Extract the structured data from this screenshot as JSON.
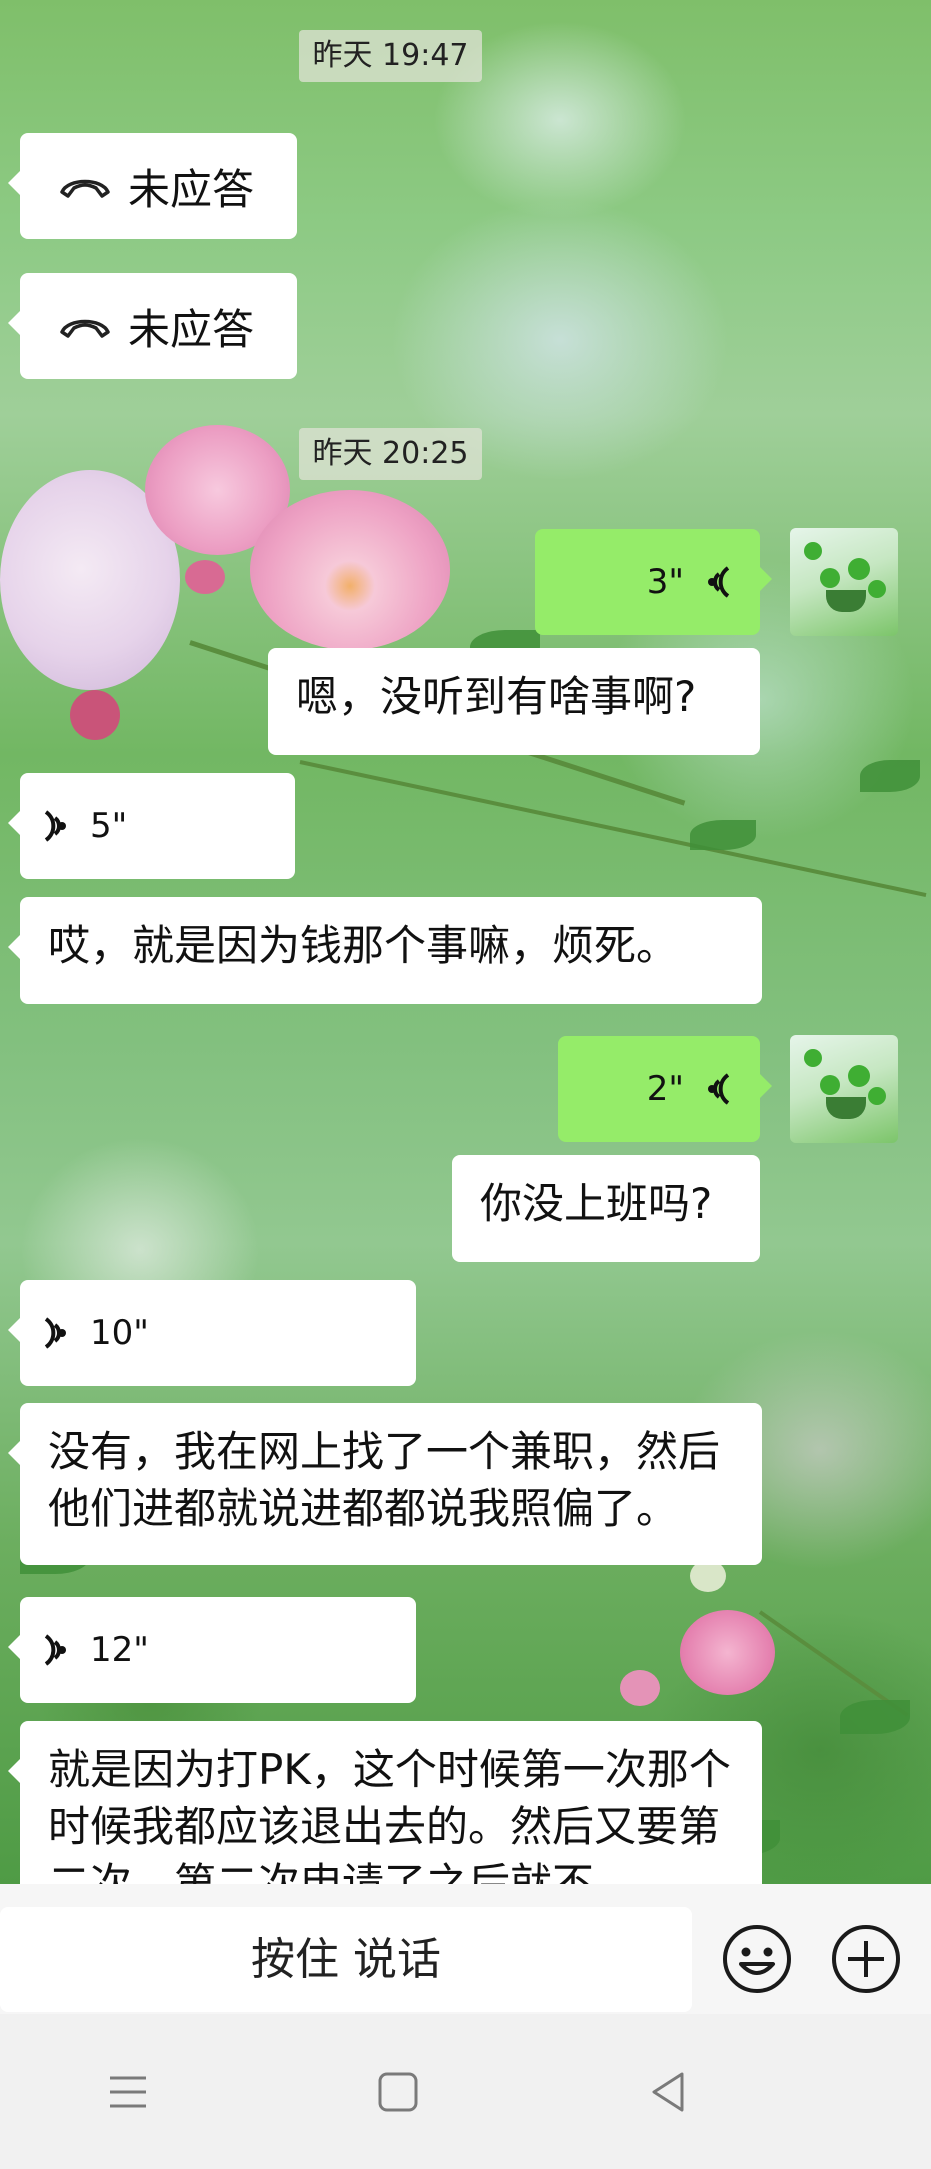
{
  "messages": {
    "time_1": "昨天 19:47",
    "missed_call_1": "未应答",
    "missed_call_2": "未应答",
    "time_2": "昨天 20:25",
    "voice_out_1": "3\"",
    "text_1": "嗯，没听到有啥事啊?",
    "voice_in_1": "5\"",
    "text_2": "哎，就是因为钱那个事嘛，烦死。",
    "voice_out_2": "2\"",
    "text_3": "你没上班吗?",
    "voice_in_2": "10\"",
    "text_4": "没有，我在网上找了一个兼职，然后他们进都就说进都都说我照偏了。",
    "voice_in_3": "12\"",
    "text_5": "就是因为打PK，这个时候第一次那个时候我都应该退出去的。然后又要第二次，第二次申请了之后就不"
  },
  "input_bar": {
    "hold_to_talk": "按住 说话"
  },
  "icons": {
    "missed_call": "phone-hangup-icon",
    "voice_in": "voice-wave-icon",
    "voice_out": "voice-wave-icon",
    "emoji": "emoji-icon",
    "more": "plus-circle-icon",
    "nav_menu": "menu-icon",
    "nav_home": "home-square-icon",
    "nav_back": "back-triangle-icon"
  },
  "colors": {
    "bubble_out": "#95ec69",
    "bubble_in": "#ffffff",
    "input_bar": "#f6f6f6"
  }
}
